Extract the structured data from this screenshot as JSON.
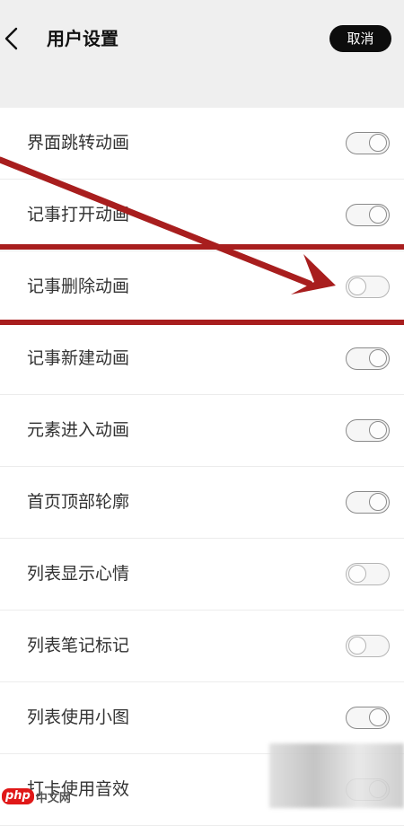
{
  "header": {
    "title": "用户设置",
    "cancel_label": "取消"
  },
  "settings": [
    {
      "label": "界面跳转动画",
      "enabled": true
    },
    {
      "label": "记事打开动画",
      "enabled": true
    },
    {
      "label": "记事删除动画",
      "enabled": false
    },
    {
      "label": "记事新建动画",
      "enabled": true
    },
    {
      "label": "元素进入动画",
      "enabled": true
    },
    {
      "label": "首页顶部轮廓",
      "enabled": true
    },
    {
      "label": "列表显示心情",
      "enabled": false
    },
    {
      "label": "列表笔记标记",
      "enabled": false
    },
    {
      "label": "列表使用小图",
      "enabled": true
    },
    {
      "label": "打卡使用音效",
      "enabled": true
    }
  ],
  "annotation": {
    "color": "#a81e1e"
  },
  "watermark": {
    "logo": "php",
    "text": "中文网"
  }
}
